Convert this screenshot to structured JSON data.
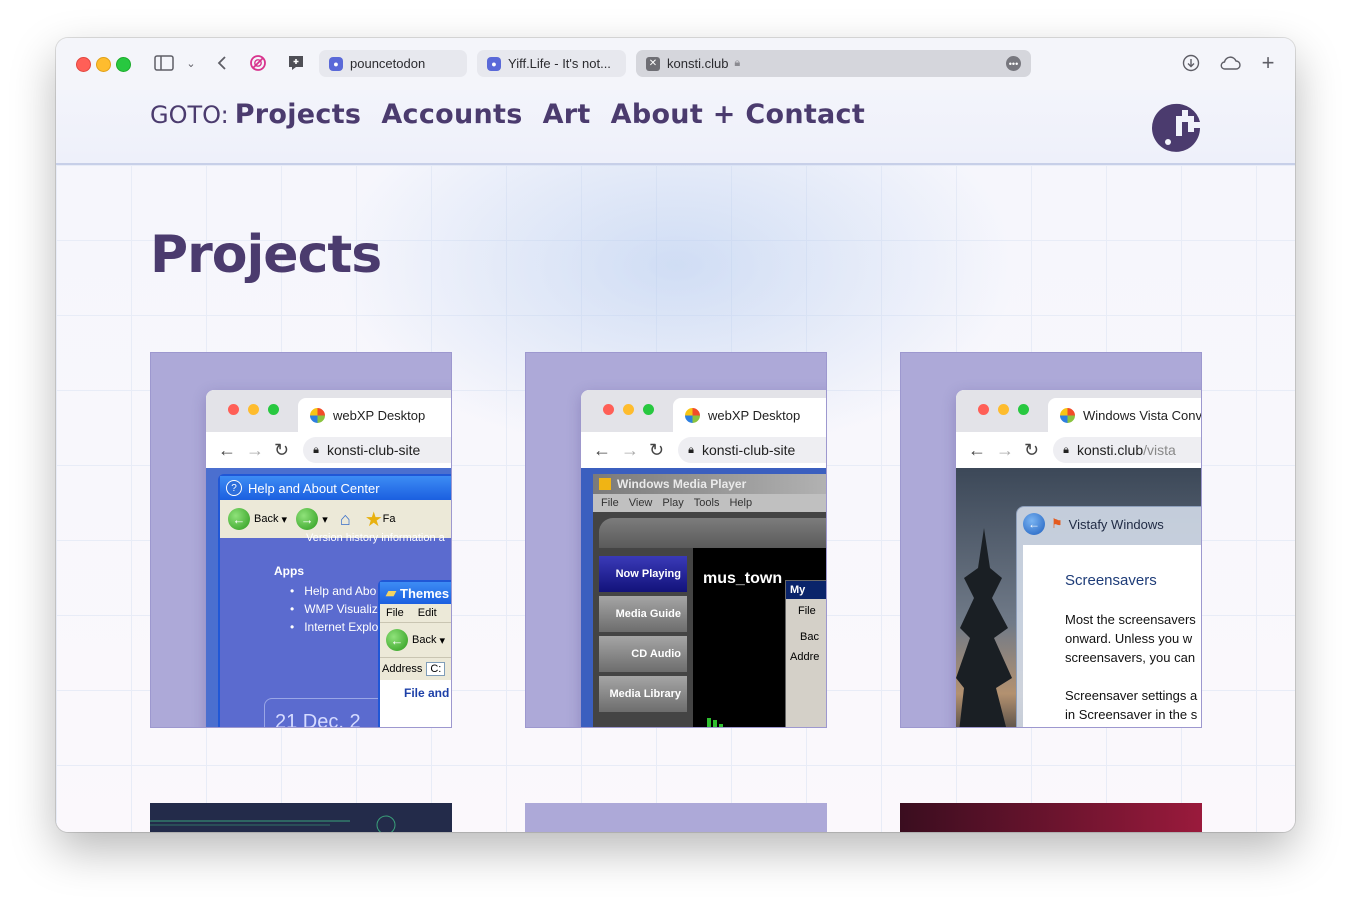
{
  "browser": {
    "tabs": [
      {
        "label": "pouncetodon",
        "active": false
      },
      {
        "label": "Yiff.Life - It's not...",
        "active": false
      },
      {
        "label": "konsti.club",
        "active": true
      }
    ]
  },
  "site": {
    "nav": {
      "goto": "GOTO:",
      "links": [
        "Projects",
        "Accounts",
        "Art",
        "About + Contact"
      ]
    },
    "title": "Projects",
    "cards": [
      {
        "tab_title": "webXP Desktop",
        "address": "konsti-club-site",
        "window_title": "Help and About Center",
        "toolbar_back": "Back",
        "toolbar_fav": "Fa",
        "line_top": "Version history information a",
        "section": "Apps",
        "items": [
          "Help and Abo",
          "WMP Visualiz",
          "Internet Explo"
        ],
        "sub_title": "Themes",
        "sub_menu": [
          "File",
          "Edit"
        ],
        "sub_back": "Back",
        "sub_address": "Address",
        "sub_address_val": "C:",
        "sub_link": "File and",
        "date": "21 Dec, 2"
      },
      {
        "tab_title": "webXP Desktop",
        "address": "konsti-club-site",
        "window_title": "Windows Media Player",
        "menu": [
          "File",
          "View",
          "Play",
          "Tools",
          "Help"
        ],
        "buttons": [
          "Now Playing",
          "Media Guide",
          "CD Audio",
          "Media Library"
        ],
        "screen_text": "mus_town",
        "sub_title": "My",
        "sub_file": "File",
        "sub_back": "Bac",
        "sub_address": "Addre"
      },
      {
        "tab_title": "Windows Vista Conv",
        "address_host": "konsti.club",
        "address_path": "/vista",
        "window_title": "Vistafy Windows",
        "heading": "Screensavers",
        "para1": [
          "Most the screensavers",
          "onward. Unless you w",
          "screensavers, you can"
        ],
        "para2": [
          "Screensaver settings a",
          "in Screensaver in the s"
        ]
      }
    ]
  },
  "colors": {
    "brand": "#4b3b6e",
    "card_bg": "#ada9d8"
  }
}
